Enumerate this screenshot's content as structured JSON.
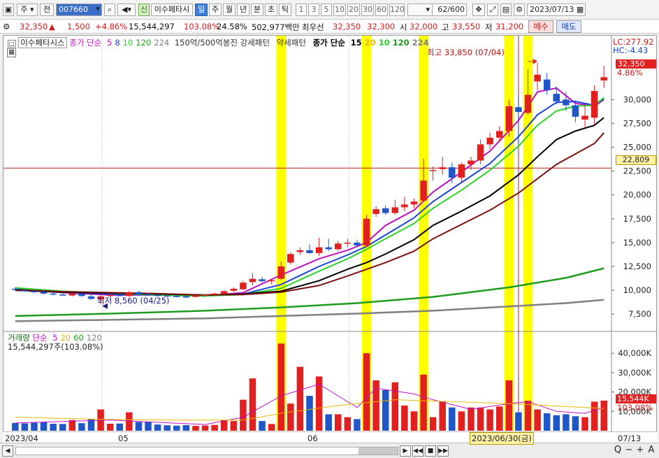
{
  "toolbar": {
    "market": "주",
    "prev": "전",
    "code": "007660",
    "new_label": "신",
    "stock_name": "이수페타시",
    "periods": [
      "일",
      "주",
      "월",
      "년",
      "분",
      "초",
      "틱"
    ],
    "active_period": "일",
    "intervals": [
      "1",
      "3",
      "5",
      "10",
      "20",
      "30",
      "60",
      "120"
    ],
    "count": "62",
    "count_total": "/600",
    "date": "2023/07/13"
  },
  "quote": {
    "price": "32,350",
    "arrow": "▲",
    "change": "1,500",
    "change_pct": "+4.86%",
    "volume": "15,544,297",
    "vol_ratio": "103.08%",
    "turnover": "24.58%",
    "amount": "502,977백만",
    "best_ask_label": "최우선",
    "best_ask": "32,350",
    "best_bid": "32,300",
    "open_label": "시",
    "open": "32,000",
    "high_label": "고",
    "high": "33,550",
    "low_label": "저",
    "low": "31,200",
    "buy_label": "매수",
    "sell_label": "매도"
  },
  "legend": {
    "name": "이수페타시스",
    "ma_title": "종가 단순",
    "ma_periods": [
      "5",
      "8",
      "10",
      "120",
      "224"
    ],
    "ma_colors": [
      "#c010c0",
      "#1a44d8",
      "#2bd42b",
      "#1f9b1f",
      "#808080"
    ],
    "strong_label": "150억/500억봉진 강세패턴",
    "weak_label": "약세패턴",
    "ma2_title": "종가 단순",
    "ma2_periods": [
      "15",
      "20",
      "10",
      "120",
      "224"
    ],
    "ma2_colors": [
      "#000000",
      "#e8b800",
      "#2bd42b",
      "#1f9b1f",
      "#808080"
    ],
    "lc_label": "LC:277.92",
    "hc_label": "HC:-4.43",
    "max_label": "최고 33,850 (07/04)",
    "min_label": "최저 8,560 (04/25)",
    "last_price_box": "32,350",
    "last_pct": "4.86%",
    "cursor_price": "22,809"
  },
  "volume_legend": {
    "title": "거래량",
    "ma_title": "단순",
    "ma_periods": [
      "5",
      "20",
      "60",
      "120"
    ],
    "ma_colors": [
      "#c010c0",
      "#e8b800",
      "#1f9b1f",
      "#808080"
    ],
    "value_text": "15,544,297주(103.08%)",
    "last_box": "15,544K",
    "last_pct": "103.08%"
  },
  "bottom": {
    "dates": [
      "2023/04",
      "05",
      "06"
    ],
    "cursor_date": "2023/06/30(금)",
    "right_date": "07/13",
    "zoom_labels": [
      "Q",
      "−",
      "+",
      "A"
    ]
  },
  "colors": {
    "up": "#e32020",
    "down": "#1f56c8",
    "highlight": "#ffff00"
  },
  "chart_data": {
    "type": "candlestick",
    "price_axis": [
      "30,000",
      "27,500",
      "25,000",
      "22,500",
      "20,000",
      "17,500",
      "15,000",
      "12,500",
      "10,000",
      "7,500"
    ],
    "price_range": [
      5900,
      34500
    ],
    "volume_axis": [
      "40,000K",
      "30,000K",
      "20,000K",
      "10,000K"
    ],
    "volume_range": [
      0,
      48000
    ],
    "highlight_indices": [
      28,
      37,
      43,
      52,
      54
    ],
    "candles": [
      {
        "o": 10150,
        "h": 10300,
        "l": 9950,
        "c": 10050,
        "v": 4000
      },
      {
        "o": 10000,
        "h": 10200,
        "l": 9850,
        "c": 9900,
        "v": 3800
      },
      {
        "o": 9900,
        "h": 10050,
        "l": 9700,
        "c": 9800,
        "v": 4100
      },
      {
        "o": 9800,
        "h": 9950,
        "l": 9550,
        "c": 9650,
        "v": 4500
      },
      {
        "o": 9650,
        "h": 9800,
        "l": 9450,
        "c": 9550,
        "v": 3600
      },
      {
        "o": 9550,
        "h": 9750,
        "l": 9400,
        "c": 9500,
        "v": 3500
      },
      {
        "o": 9450,
        "h": 9750,
        "l": 9350,
        "c": 9650,
        "v": 5500
      },
      {
        "o": 9600,
        "h": 9700,
        "l": 9300,
        "c": 9400,
        "v": 3900
      },
      {
        "o": 9350,
        "h": 9500,
        "l": 9000,
        "c": 9100,
        "v": 6000
      },
      {
        "o": 9050,
        "h": 9500,
        "l": 8560,
        "c": 9350,
        "v": 11000
      },
      {
        "o": 9400,
        "h": 9600,
        "l": 9300,
        "c": 9500,
        "v": 3600
      },
      {
        "o": 9500,
        "h": 9650,
        "l": 9350,
        "c": 9400,
        "v": 3700
      },
      {
        "o": 9400,
        "h": 9950,
        "l": 9300,
        "c": 9800,
        "v": 9500
      },
      {
        "o": 9800,
        "h": 9950,
        "l": 9500,
        "c": 9600,
        "v": 4500
      },
      {
        "o": 9600,
        "h": 9700,
        "l": 9400,
        "c": 9500,
        "v": 4500
      },
      {
        "o": 9500,
        "h": 9600,
        "l": 9350,
        "c": 9450,
        "v": 3200
      },
      {
        "o": 9450,
        "h": 9550,
        "l": 9300,
        "c": 9400,
        "v": 2800
      },
      {
        "o": 9400,
        "h": 9500,
        "l": 9250,
        "c": 9350,
        "v": 2600
      },
      {
        "o": 9350,
        "h": 9450,
        "l": 9200,
        "c": 9300,
        "v": 2900
      },
      {
        "o": 9300,
        "h": 9500,
        "l": 9250,
        "c": 9450,
        "v": 2500
      },
      {
        "o": 9450,
        "h": 9600,
        "l": 9300,
        "c": 9550,
        "v": 2700
      },
      {
        "o": 9550,
        "h": 9750,
        "l": 9400,
        "c": 9650,
        "v": 3000
      },
      {
        "o": 9650,
        "h": 10000,
        "l": 9550,
        "c": 9900,
        "v": 5500
      },
      {
        "o": 9950,
        "h": 10300,
        "l": 9800,
        "c": 10150,
        "v": 5000
      },
      {
        "o": 10100,
        "h": 11000,
        "l": 10000,
        "c": 10800,
        "v": 16000
      },
      {
        "o": 10850,
        "h": 11800,
        "l": 10500,
        "c": 11200,
        "v": 27000
      },
      {
        "o": 11150,
        "h": 11400,
        "l": 10800,
        "c": 10950,
        "v": 5000
      },
      {
        "o": 10950,
        "h": 11200,
        "l": 10600,
        "c": 11050,
        "v": 3500
      },
      {
        "o": 11200,
        "h": 13000,
        "l": 11100,
        "c": 12500,
        "v": 45000
      },
      {
        "o": 12900,
        "h": 14000,
        "l": 12700,
        "c": 13800,
        "v": 14000
      },
      {
        "o": 14000,
        "h": 14500,
        "l": 13700,
        "c": 14200,
        "v": 33000
      },
      {
        "o": 14200,
        "h": 14800,
        "l": 13800,
        "c": 13900,
        "v": 18000
      },
      {
        "o": 13900,
        "h": 15500,
        "l": 13600,
        "c": 14500,
        "v": 28000
      },
      {
        "o": 14500,
        "h": 15400,
        "l": 14100,
        "c": 14300,
        "v": 8500
      },
      {
        "o": 14300,
        "h": 15200,
        "l": 14100,
        "c": 14900,
        "v": 8500
      },
      {
        "o": 14900,
        "h": 15400,
        "l": 14500,
        "c": 15000,
        "v": 7000
      },
      {
        "o": 15000,
        "h": 15300,
        "l": 14600,
        "c": 14700,
        "v": 6000
      },
      {
        "o": 14700,
        "h": 17900,
        "l": 14500,
        "c": 17500,
        "v": 40000
      },
      {
        "o": 18000,
        "h": 18800,
        "l": 17700,
        "c": 18500,
        "v": 26000
      },
      {
        "o": 18600,
        "h": 18900,
        "l": 17900,
        "c": 18100,
        "v": 21000
      },
      {
        "o": 18100,
        "h": 19500,
        "l": 17900,
        "c": 18700,
        "v": 25000
      },
      {
        "o": 18700,
        "h": 19800,
        "l": 18300,
        "c": 19000,
        "v": 13000
      },
      {
        "o": 19000,
        "h": 19600,
        "l": 18600,
        "c": 19300,
        "v": 10000
      },
      {
        "o": 19400,
        "h": 23800,
        "l": 19300,
        "c": 21500,
        "v": 29000
      },
      {
        "o": 22500,
        "h": 23000,
        "l": 21500,
        "c": 22600,
        "v": 7000
      },
      {
        "o": 22700,
        "h": 24000,
        "l": 22100,
        "c": 22900,
        "v": 15000
      },
      {
        "o": 22900,
        "h": 23400,
        "l": 21200,
        "c": 21800,
        "v": 12000
      },
      {
        "o": 21800,
        "h": 23400,
        "l": 21400,
        "c": 23200,
        "v": 10000
      },
      {
        "o": 23200,
        "h": 24000,
        "l": 22600,
        "c": 23600,
        "v": 12000
      },
      {
        "o": 23600,
        "h": 25800,
        "l": 23200,
        "c": 25300,
        "v": 12000
      },
      {
        "o": 25300,
        "h": 26500,
        "l": 24800,
        "c": 26000,
        "v": 11000
      },
      {
        "o": 26000,
        "h": 27200,
        "l": 25600,
        "c": 26700,
        "v": 12500
      },
      {
        "o": 26700,
        "h": 30000,
        "l": 26100,
        "c": 29300,
        "v": 26000
      },
      {
        "o": 29200,
        "h": 30500,
        "l": 25300,
        "c": 28700,
        "v": 9500
      },
      {
        "o": 28600,
        "h": 33200,
        "l": 28400,
        "c": 30500,
        "v": 15500
      },
      {
        "o": 31900,
        "h": 33850,
        "l": 31000,
        "c": 32600,
        "v": 11000
      },
      {
        "o": 32100,
        "h": 32800,
        "l": 30500,
        "c": 31000,
        "v": 9000
      },
      {
        "o": 30600,
        "h": 31400,
        "l": 29500,
        "c": 29800,
        "v": 8000
      },
      {
        "o": 30000,
        "h": 30800,
        "l": 28800,
        "c": 29400,
        "v": 8500
      },
      {
        "o": 29400,
        "h": 29800,
        "l": 27600,
        "c": 28200,
        "v": 7500
      },
      {
        "o": 27900,
        "h": 29400,
        "l": 27100,
        "c": 28300,
        "v": 7000
      },
      {
        "o": 28100,
        "h": 31500,
        "l": 27300,
        "c": 30900,
        "v": 15000
      },
      {
        "o": 32000,
        "h": 33550,
        "l": 31200,
        "c": 32350,
        "v": 15544
      }
    ],
    "ma_lines": [
      {
        "period": "5",
        "color": "#c010c0",
        "values": [
          [
            0,
            10100
          ],
          [
            5,
            9750
          ],
          [
            10,
            9500
          ],
          [
            15,
            9500
          ],
          [
            20,
            9400
          ],
          [
            24,
            9750
          ],
          [
            28,
            11600
          ],
          [
            32,
            13300
          ],
          [
            35,
            14200
          ],
          [
            37,
            15000
          ],
          [
            39,
            16800
          ],
          [
            42,
            18400
          ],
          [
            44,
            20300
          ],
          [
            47,
            22400
          ],
          [
            50,
            24600
          ],
          [
            53,
            27800
          ],
          [
            55,
            30800
          ],
          [
            57,
            31200
          ],
          [
            59,
            29600
          ],
          [
            61,
            29300
          ],
          [
            62,
            30000
          ]
        ]
      },
      {
        "period": "8",
        "color": "#1a44d8",
        "values": [
          [
            0,
            10150
          ],
          [
            5,
            9800
          ],
          [
            10,
            9600
          ],
          [
            15,
            9500
          ],
          [
            20,
            9400
          ],
          [
            24,
            9600
          ],
          [
            28,
            10600
          ],
          [
            32,
            12500
          ],
          [
            35,
            13700
          ],
          [
            37,
            14600
          ],
          [
            39,
            15800
          ],
          [
            42,
            17600
          ],
          [
            44,
            19300
          ],
          [
            47,
            21300
          ],
          [
            50,
            23300
          ],
          [
            53,
            26100
          ],
          [
            55,
            28400
          ],
          [
            57,
            29700
          ],
          [
            59,
            29800
          ],
          [
            61,
            29400
          ],
          [
            62,
            30100
          ]
        ]
      },
      {
        "period": "10",
        "color": "#2bd42b",
        "values": [
          [
            0,
            10250
          ],
          [
            5,
            9900
          ],
          [
            10,
            9700
          ],
          [
            15,
            9500
          ],
          [
            20,
            9400
          ],
          [
            24,
            9550
          ],
          [
            28,
            10200
          ],
          [
            32,
            12000
          ],
          [
            35,
            13300
          ],
          [
            37,
            14300
          ],
          [
            39,
            15400
          ],
          [
            42,
            17000
          ],
          [
            44,
            18600
          ],
          [
            47,
            20500
          ],
          [
            50,
            22600
          ],
          [
            53,
            25100
          ],
          [
            55,
            27300
          ],
          [
            57,
            28800
          ],
          [
            59,
            29300
          ],
          [
            61,
            29400
          ],
          [
            62,
            30200
          ]
        ]
      },
      {
        "period": "15",
        "color": "#000000",
        "values": [
          [
            0,
            10000
          ],
          [
            5,
            9800
          ],
          [
            10,
            9700
          ],
          [
            15,
            9600
          ],
          [
            20,
            9500
          ],
          [
            24,
            9600
          ],
          [
            28,
            9900
          ],
          [
            32,
            11000
          ],
          [
            35,
            12200
          ],
          [
            37,
            12900
          ],
          [
            39,
            13800
          ],
          [
            42,
            15300
          ],
          [
            44,
            16800
          ],
          [
            47,
            18300
          ],
          [
            50,
            19900
          ],
          [
            53,
            22100
          ],
          [
            55,
            24000
          ],
          [
            57,
            25800
          ],
          [
            59,
            26700
          ],
          [
            61,
            27300
          ],
          [
            62,
            28100
          ]
        ]
      },
      {
        "period": "20",
        "color": "#7a1010",
        "values": [
          [
            0,
            10050
          ],
          [
            5,
            9850
          ],
          [
            10,
            9750
          ],
          [
            15,
            9650
          ],
          [
            20,
            9500
          ],
          [
            24,
            9550
          ],
          [
            28,
            9800
          ],
          [
            32,
            10500
          ],
          [
            35,
            11500
          ],
          [
            37,
            12200
          ],
          [
            39,
            12900
          ],
          [
            42,
            14100
          ],
          [
            44,
            15400
          ],
          [
            47,
            16900
          ],
          [
            50,
            18400
          ],
          [
            53,
            20200
          ],
          [
            55,
            21700
          ],
          [
            57,
            23200
          ],
          [
            59,
            24300
          ],
          [
            61,
            25400
          ],
          [
            62,
            26500
          ]
        ]
      },
      {
        "period": "120",
        "color": "#1f9b1f",
        "values": [
          [
            0,
            7300
          ],
          [
            10,
            7550
          ],
          [
            20,
            7850
          ],
          [
            28,
            8200
          ],
          [
            36,
            8650
          ],
          [
            44,
            9300
          ],
          [
            52,
            10300
          ],
          [
            58,
            11300
          ],
          [
            62,
            12300
          ]
        ]
      },
      {
        "period": "224",
        "color": "#808080",
        "values": [
          [
            0,
            6750
          ],
          [
            10,
            6900
          ],
          [
            20,
            7050
          ],
          [
            28,
            7300
          ],
          [
            36,
            7550
          ],
          [
            44,
            7850
          ],
          [
            52,
            8300
          ],
          [
            58,
            8650
          ],
          [
            62,
            9000
          ]
        ]
      }
    ],
    "vol_ma_lines": [
      {
        "period": "5",
        "color": "#c010c0",
        "values": [
          [
            0,
            4000
          ],
          [
            10,
            5500
          ],
          [
            20,
            3200
          ],
          [
            24,
            7000
          ],
          [
            28,
            18000
          ],
          [
            32,
            24000
          ],
          [
            36,
            12000
          ],
          [
            38,
            22000
          ],
          [
            42,
            19000
          ],
          [
            44,
            16000
          ],
          [
            48,
            11000
          ],
          [
            52,
            14000
          ],
          [
            54,
            15000
          ],
          [
            57,
            10000
          ],
          [
            60,
            9000
          ],
          [
            62,
            12000
          ]
        ]
      },
      {
        "period": "20",
        "color": "#e8b800",
        "values": [
          [
            0,
            7000
          ],
          [
            8,
            6000
          ],
          [
            16,
            5500
          ],
          [
            24,
            5500
          ],
          [
            28,
            9000
          ],
          [
            34,
            13000
          ],
          [
            40,
            16000
          ],
          [
            46,
            15000
          ],
          [
            52,
            14000
          ],
          [
            58,
            12500
          ],
          [
            62,
            11500
          ]
        ]
      }
    ]
  }
}
